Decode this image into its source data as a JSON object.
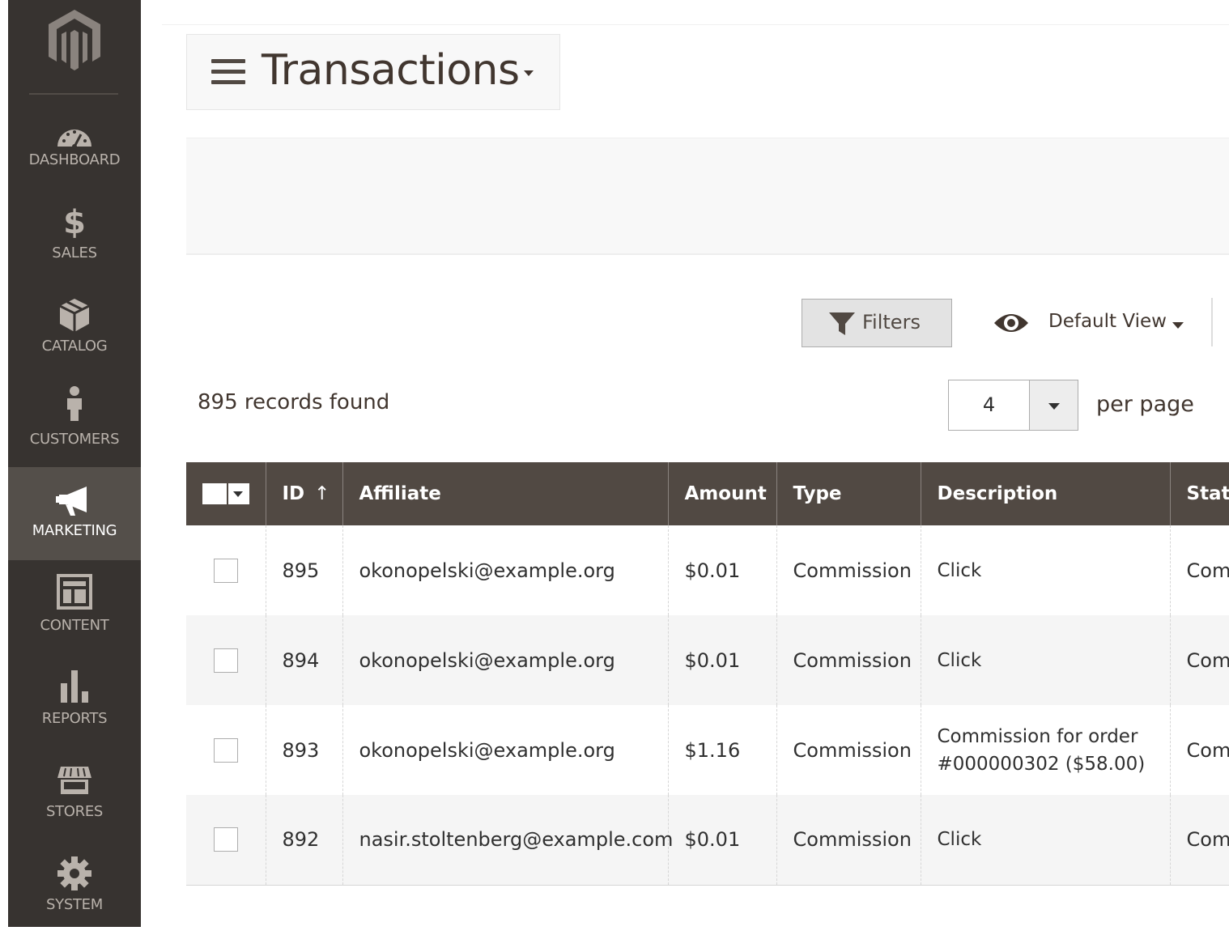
{
  "sidebar": {
    "items": [
      {
        "label": "DASHBOARD",
        "icon": "dashboard-icon"
      },
      {
        "label": "SALES",
        "icon": "dollar-icon"
      },
      {
        "label": "CATALOG",
        "icon": "box-icon"
      },
      {
        "label": "CUSTOMERS",
        "icon": "person-icon"
      },
      {
        "label": "MARKETING",
        "icon": "megaphone-icon",
        "active": true
      },
      {
        "label": "CONTENT",
        "icon": "layout-icon"
      },
      {
        "label": "REPORTS",
        "icon": "bar-chart-icon"
      },
      {
        "label": "STORES",
        "icon": "storefront-icon"
      },
      {
        "label": "SYSTEM",
        "icon": "gear-icon"
      }
    ]
  },
  "header": {
    "title": "Transactions"
  },
  "toolbar": {
    "filters_label": "Filters",
    "view_label": "Default View",
    "records_found": "895 records found",
    "per_page_value": "4",
    "per_page_label": "per page"
  },
  "grid": {
    "columns": [
      "ID",
      "Affiliate",
      "Amount",
      "Type",
      "Description",
      "Status"
    ],
    "sort_indicator": "↑",
    "rows": [
      {
        "id": "895",
        "affiliate": "okonopelski@example.org",
        "amount": "$0.01",
        "type": "Commission",
        "description": "Click",
        "status": "Completed"
      },
      {
        "id": "894",
        "affiliate": "okonopelski@example.org",
        "amount": "$0.01",
        "type": "Commission",
        "description": "Click",
        "status": "Completed"
      },
      {
        "id": "893",
        "affiliate": "okonopelski@example.org",
        "amount": "$1.16",
        "type": "Commission",
        "description": "Commission for order #000000302 ($58.00)",
        "status": "Completed"
      },
      {
        "id": "892",
        "affiliate": "nasir.stoltenberg@example.com",
        "amount": "$0.01",
        "type": "Commission",
        "description": "Click",
        "status": "Completed"
      }
    ]
  },
  "colors": {
    "sidebar_bg": "#373330",
    "sidebar_active": "#544f4a",
    "header_row_bg": "#514943",
    "text": "#303030"
  }
}
